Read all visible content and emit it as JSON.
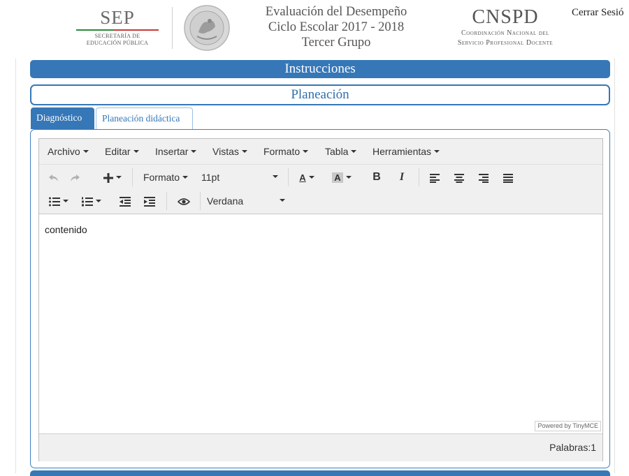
{
  "header": {
    "sep_logo": {
      "title": "SEP",
      "subtitle_line1": "SECRETARÍA DE",
      "subtitle_line2": "EDUCACIÓN PÚBLICA"
    },
    "seal_icon": "mexican-coat-of-arms-seal",
    "title_lines": [
      "Evaluación del Desempeño",
      "Ciclo Escolar 2017 - 2018",
      "Tercer Grupo"
    ],
    "cnspd_logo": {
      "title": "CNSPD",
      "subtitle_line1": "Coordinación Nacional del",
      "subtitle_line2": "Servicio Profesional Docente"
    },
    "logout_label": "Cerrar Sesió"
  },
  "sections": {
    "instrucciones": "Instrucciones",
    "planeacion": "Planeación"
  },
  "tabs": [
    {
      "label": "Diagnóstico",
      "active": true
    },
    {
      "label": "Planeación didáctica",
      "active": false
    }
  ],
  "editor": {
    "menu": [
      "Archivo",
      "Editar",
      "Insertar",
      "Vistas",
      "Formato",
      "Tabla",
      "Herramientas"
    ],
    "toolbar": {
      "undo_icon": "undo-icon",
      "redo_icon": "redo-icon",
      "insert_icon": "plus-icon",
      "format_label": "Formato",
      "font_size": "11pt",
      "text_color_label": "A",
      "bg_color_label": "A",
      "bold_label": "B",
      "italic_label": "I",
      "font_family": "Verdana"
    },
    "content": "contenido",
    "powered_by": "Powered by TinyMCE",
    "word_count": "Palabras:1"
  },
  "colors": {
    "primary": "#3677b8",
    "tab_active_text": "#ffffff",
    "toolbar_bg": "#f0f0f0"
  }
}
